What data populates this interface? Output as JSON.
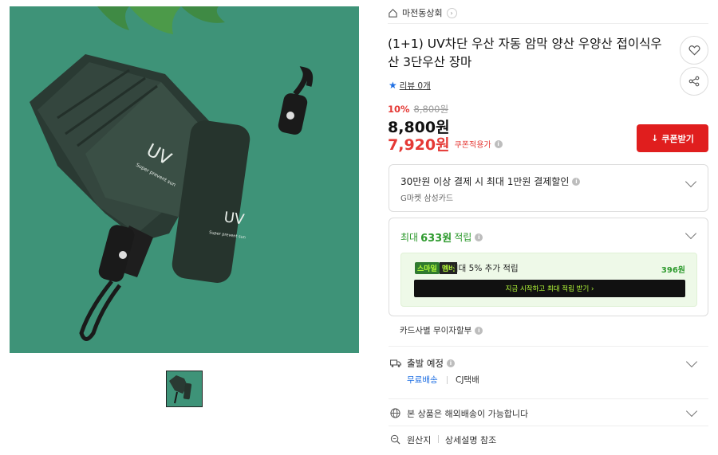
{
  "store": {
    "name": "마전동상회"
  },
  "product": {
    "title": "(1+1) UV차단 우산 자동 암막 양산 우양산 접이식우산 3단우산 장마",
    "image_alt": "UV 차단 접이식 우산 (초록색)"
  },
  "review": {
    "label": "리뷰 0개"
  },
  "price": {
    "discount_rate": "10%",
    "original": "8,800원",
    "sale": "8,800원",
    "coupon_price": "7,920원",
    "coupon_label": "쿠폰적용가",
    "coupon_button": "쿠폰받기"
  },
  "card_benefit": {
    "title": "30만원 이상 결제 시 최대 1만원 결제할인",
    "card": "G마켓 삼성카드"
  },
  "points": {
    "prefix": "최대",
    "amount": "633원",
    "suffix": "적립",
    "club_badge_a": "스마일",
    "club_badge_b": "멤버",
    "club_text": "최대 5% 추가 적립",
    "club_amount": "396원",
    "club_button": "지금 시작하고 최대 적립 받기  ›"
  },
  "installment": {
    "label": "카드사별 무이자할부"
  },
  "shipping": {
    "label": "출발 예정",
    "fee": "무료배송",
    "carrier": "CJ택배"
  },
  "overseas": {
    "text": "본 상품은 해외배송이 가능합니다"
  },
  "origin": {
    "label": "원산지",
    "value": "상세설명 참조"
  },
  "colors": {
    "accent_red": "#e01e1e",
    "point_green": "#2e9a2e",
    "link_blue": "#1f6fe3",
    "image_bg": "#3e9378"
  }
}
